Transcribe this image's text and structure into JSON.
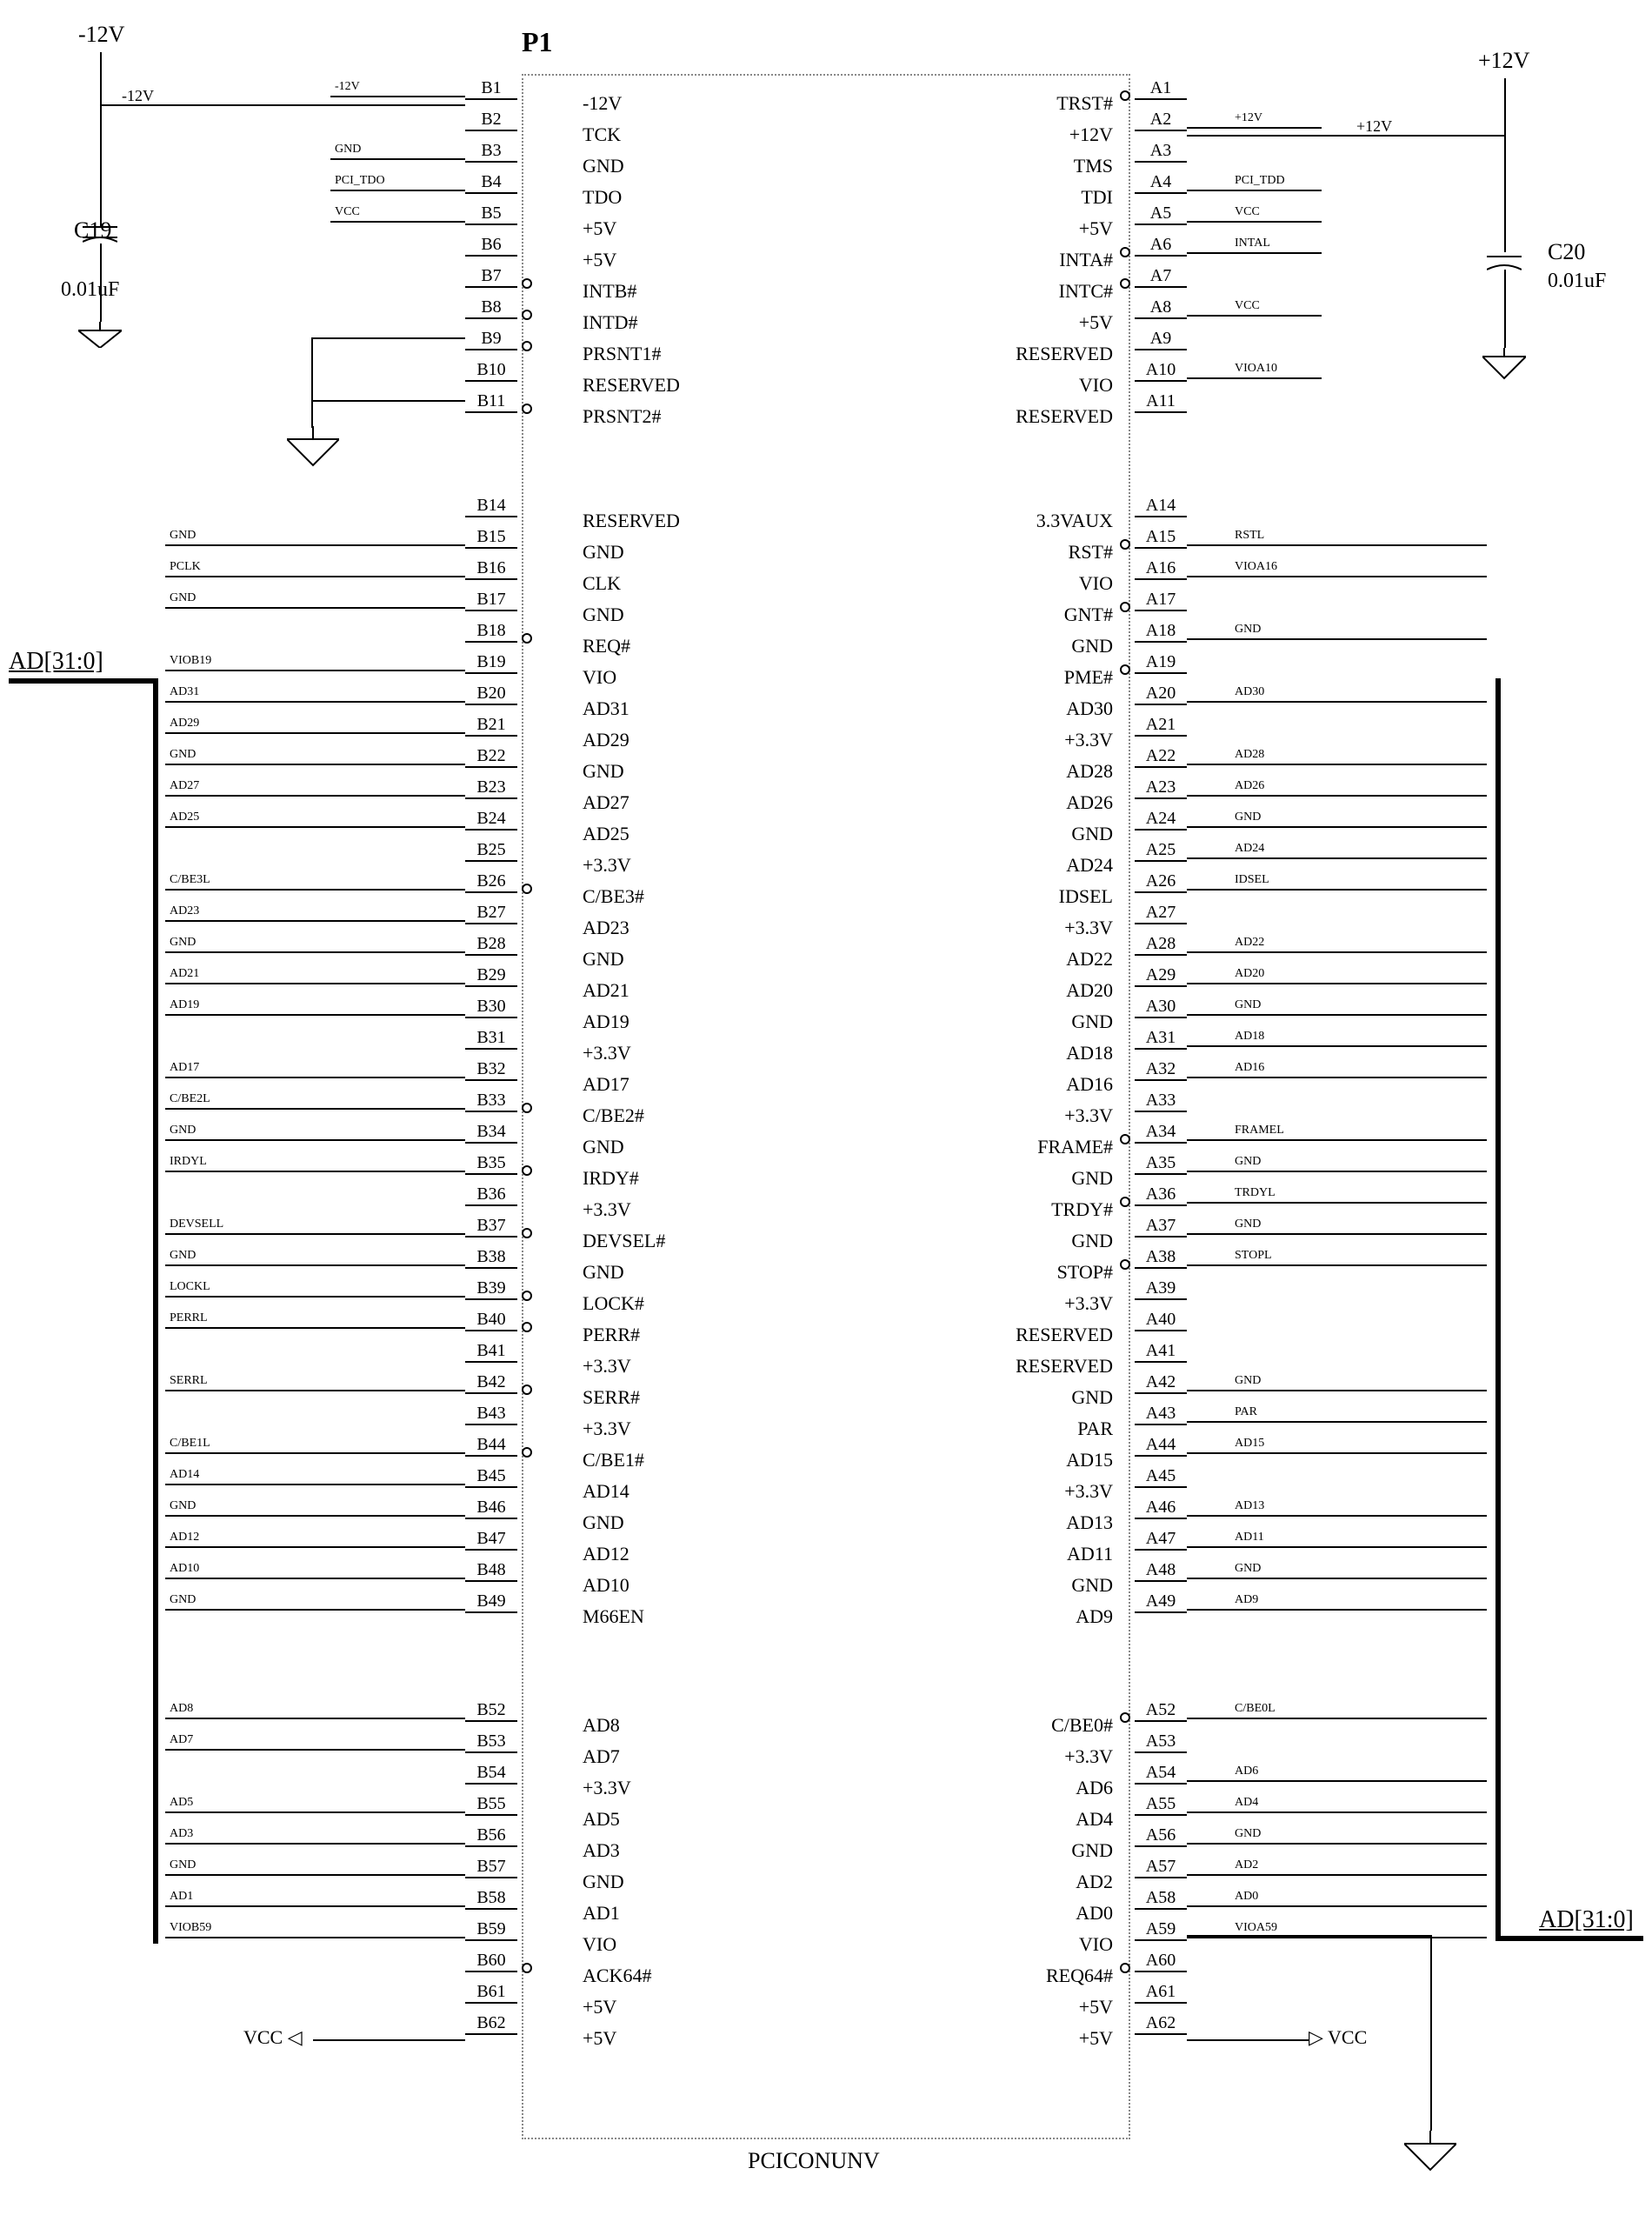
{
  "connector": {
    "refdes": "P1",
    "footprint": "PCICONUNV"
  },
  "power_rails": {
    "neg12": "-12V",
    "pos12": "+12V"
  },
  "caps": {
    "c19": {
      "ref": "C19",
      "value": "0.01uF"
    },
    "c20": {
      "ref": "C20",
      "value": "0.01uF"
    }
  },
  "bus_labels": {
    "left": "AD[31:0]",
    "right": "AD[31:0]"
  },
  "vcc": "VCC",
  "pins_b": [
    {
      "num": "B1",
      "func": "-12V",
      "net": "-12V"
    },
    {
      "num": "B2",
      "func": "TCK",
      "net": ""
    },
    {
      "num": "B3",
      "func": "GND",
      "net": "GND"
    },
    {
      "num": "B4",
      "func": "TDO",
      "net": "PCI_TDO"
    },
    {
      "num": "B5",
      "func": "+5V",
      "net": "VCC"
    },
    {
      "num": "B6",
      "func": "+5V",
      "net": ""
    },
    {
      "num": "B7",
      "func": "INTB#",
      "net": "",
      "inv": true
    },
    {
      "num": "B8",
      "func": "INTD#",
      "net": "",
      "inv": true
    },
    {
      "num": "B9",
      "func": "PRSNT1#",
      "net": "",
      "inv": true
    },
    {
      "num": "B10",
      "func": "RESERVED",
      "net": ""
    },
    {
      "num": "B11",
      "func": "PRSNT2#",
      "net": "",
      "inv": true
    },
    {
      "num": "B14",
      "func": "RESERVED",
      "net": ""
    },
    {
      "num": "B15",
      "func": "GND",
      "net": "GND"
    },
    {
      "num": "B16",
      "func": "CLK",
      "net": "PCLK"
    },
    {
      "num": "B17",
      "func": "GND",
      "net": "GND"
    },
    {
      "num": "B18",
      "func": "REQ#",
      "net": "",
      "inv": true
    },
    {
      "num": "B19",
      "func": "VIO",
      "net": "VIOB19"
    },
    {
      "num": "B20",
      "func": "AD31",
      "net": "AD31"
    },
    {
      "num": "B21",
      "func": "AD29",
      "net": "AD29"
    },
    {
      "num": "B22",
      "func": "GND",
      "net": "GND"
    },
    {
      "num": "B23",
      "func": "AD27",
      "net": "AD27"
    },
    {
      "num": "B24",
      "func": "AD25",
      "net": "AD25"
    },
    {
      "num": "B25",
      "func": "+3.3V",
      "net": ""
    },
    {
      "num": "B26",
      "func": "C/BE3#",
      "net": "C/BE3L",
      "inv": true
    },
    {
      "num": "B27",
      "func": "AD23",
      "net": "AD23"
    },
    {
      "num": "B28",
      "func": "GND",
      "net": "GND"
    },
    {
      "num": "B29",
      "func": "AD21",
      "net": "AD21"
    },
    {
      "num": "B30",
      "func": "AD19",
      "net": "AD19"
    },
    {
      "num": "B31",
      "func": "+3.3V",
      "net": ""
    },
    {
      "num": "B32",
      "func": "AD17",
      "net": "AD17"
    },
    {
      "num": "B33",
      "func": "C/BE2#",
      "net": "C/BE2L",
      "inv": true
    },
    {
      "num": "B34",
      "func": "GND",
      "net": "GND"
    },
    {
      "num": "B35",
      "func": "IRDY#",
      "net": "IRDYL",
      "inv": true
    },
    {
      "num": "B36",
      "func": "+3.3V",
      "net": ""
    },
    {
      "num": "B37",
      "func": "DEVSEL#",
      "net": "DEVSELL",
      "inv": true
    },
    {
      "num": "B38",
      "func": "GND",
      "net": "GND"
    },
    {
      "num": "B39",
      "func": "LOCK#",
      "net": "LOCKL",
      "inv": true
    },
    {
      "num": "B40",
      "func": "PERR#",
      "net": "PERRL",
      "inv": true
    },
    {
      "num": "B41",
      "func": "+3.3V",
      "net": ""
    },
    {
      "num": "B42",
      "func": "SERR#",
      "net": "SERRL",
      "inv": true
    },
    {
      "num": "B43",
      "func": "+3.3V",
      "net": ""
    },
    {
      "num": "B44",
      "func": "C/BE1#",
      "net": "C/BE1L",
      "inv": true
    },
    {
      "num": "B45",
      "func": "AD14",
      "net": "AD14"
    },
    {
      "num": "B46",
      "func": "GND",
      "net": "GND"
    },
    {
      "num": "B47",
      "func": "AD12",
      "net": "AD12"
    },
    {
      "num": "B48",
      "func": "AD10",
      "net": "AD10"
    },
    {
      "num": "B49",
      "func": "M66EN",
      "net": "GND"
    },
    {
      "num": "B52",
      "func": "AD8",
      "net": "AD8"
    },
    {
      "num": "B53",
      "func": "AD7",
      "net": "AD7"
    },
    {
      "num": "B54",
      "func": "+3.3V",
      "net": ""
    },
    {
      "num": "B55",
      "func": "AD5",
      "net": "AD5"
    },
    {
      "num": "B56",
      "func": "AD3",
      "net": "AD3"
    },
    {
      "num": "B57",
      "func": "GND",
      "net": "GND"
    },
    {
      "num": "B58",
      "func": "AD1",
      "net": "AD1"
    },
    {
      "num": "B59",
      "func": "VIO",
      "net": "VIOB59"
    },
    {
      "num": "B60",
      "func": "ACK64#",
      "net": "",
      "inv": true
    },
    {
      "num": "B61",
      "func": "+5V",
      "net": ""
    },
    {
      "num": "B62",
      "func": "+5V",
      "net": ""
    }
  ],
  "pins_a": [
    {
      "num": "A1",
      "func": "TRST#",
      "net": "",
      "inv": true
    },
    {
      "num": "A2",
      "func": "+12V",
      "net": "+12V"
    },
    {
      "num": "A3",
      "func": "TMS",
      "net": ""
    },
    {
      "num": "A4",
      "func": "TDI",
      "net": "PCI_TDD"
    },
    {
      "num": "A5",
      "func": "+5V",
      "net": "VCC"
    },
    {
      "num": "A6",
      "func": "INTA#",
      "net": "INTAL",
      "inv": true
    },
    {
      "num": "A7",
      "func": "INTC#",
      "net": "",
      "inv": true
    },
    {
      "num": "A8",
      "func": "+5V",
      "net": "VCC"
    },
    {
      "num": "A9",
      "func": "RESERVED",
      "net": ""
    },
    {
      "num": "A10",
      "func": "VIO",
      "net": "VIOA10"
    },
    {
      "num": "A11",
      "func": "RESERVED",
      "net": ""
    },
    {
      "num": "A14",
      "func": "3.3VAUX",
      "net": ""
    },
    {
      "num": "A15",
      "func": "RST#",
      "net": "RSTL",
      "inv": true
    },
    {
      "num": "A16",
      "func": "VIO",
      "net": "VIOA16"
    },
    {
      "num": "A17",
      "func": "GNT#",
      "net": "",
      "inv": true
    },
    {
      "num": "A18",
      "func": "GND",
      "net": "GND"
    },
    {
      "num": "A19",
      "func": "PME#",
      "net": "",
      "inv": true
    },
    {
      "num": "A20",
      "func": "AD30",
      "net": "AD30"
    },
    {
      "num": "A21",
      "func": "+3.3V",
      "net": ""
    },
    {
      "num": "A22",
      "func": "AD28",
      "net": "AD28"
    },
    {
      "num": "A23",
      "func": "AD26",
      "net": "AD26"
    },
    {
      "num": "A24",
      "func": "GND",
      "net": "GND"
    },
    {
      "num": "A25",
      "func": "AD24",
      "net": "AD24"
    },
    {
      "num": "A26",
      "func": "IDSEL",
      "net": "IDSEL"
    },
    {
      "num": "A27",
      "func": "+3.3V",
      "net": ""
    },
    {
      "num": "A28",
      "func": "AD22",
      "net": "AD22"
    },
    {
      "num": "A29",
      "func": "AD20",
      "net": "AD20"
    },
    {
      "num": "A30",
      "func": "GND",
      "net": "GND"
    },
    {
      "num": "A31",
      "func": "AD18",
      "net": "AD18"
    },
    {
      "num": "A32",
      "func": "AD16",
      "net": "AD16"
    },
    {
      "num": "A33",
      "func": "+3.3V",
      "net": ""
    },
    {
      "num": "A34",
      "func": "FRAME#",
      "net": "FRAMEL",
      "inv": true
    },
    {
      "num": "A35",
      "func": "GND",
      "net": "GND"
    },
    {
      "num": "A36",
      "func": "TRDY#",
      "net": "TRDYL",
      "inv": true
    },
    {
      "num": "A37",
      "func": "GND",
      "net": "GND"
    },
    {
      "num": "A38",
      "func": "STOP#",
      "net": "STOPL",
      "inv": true
    },
    {
      "num": "A39",
      "func": "+3.3V",
      "net": ""
    },
    {
      "num": "A40",
      "func": "RESERVED",
      "net": ""
    },
    {
      "num": "A41",
      "func": "RESERVED",
      "net": ""
    },
    {
      "num": "A42",
      "func": "GND",
      "net": "GND"
    },
    {
      "num": "A43",
      "func": "PAR",
      "net": "PAR"
    },
    {
      "num": "A44",
      "func": "AD15",
      "net": "AD15"
    },
    {
      "num": "A45",
      "func": "+3.3V",
      "net": ""
    },
    {
      "num": "A46",
      "func": "AD13",
      "net": "AD13"
    },
    {
      "num": "A47",
      "func": "AD11",
      "net": "AD11"
    },
    {
      "num": "A48",
      "func": "GND",
      "net": "GND"
    },
    {
      "num": "A49",
      "func": "AD9",
      "net": "AD9"
    },
    {
      "num": "A52",
      "func": "C/BE0#",
      "net": "C/BE0L",
      "inv": true
    },
    {
      "num": "A53",
      "func": "+3.3V",
      "net": ""
    },
    {
      "num": "A54",
      "func": "AD6",
      "net": "AD6"
    },
    {
      "num": "A55",
      "func": "AD4",
      "net": "AD4"
    },
    {
      "num": "A56",
      "func": "GND",
      "net": "GND"
    },
    {
      "num": "A57",
      "func": "AD2",
      "net": "AD2"
    },
    {
      "num": "A58",
      "func": "AD0",
      "net": "AD0"
    },
    {
      "num": "A59",
      "func": "VIO",
      "net": "VIOA59"
    },
    {
      "num": "A60",
      "func": "REQ64#",
      "net": "",
      "inv": true
    },
    {
      "num": "A61",
      "func": "+5V",
      "net": ""
    },
    {
      "num": "A62",
      "func": "+5V",
      "net": ""
    }
  ]
}
